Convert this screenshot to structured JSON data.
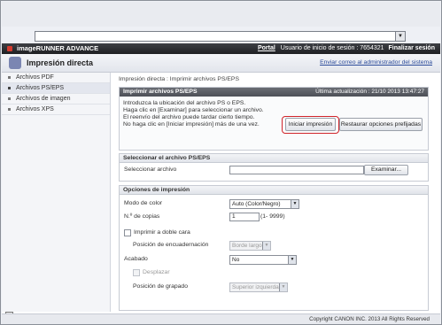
{
  "header": {
    "brand": "imageRUNNER ADVANCE",
    "portal": "Portal",
    "login": "Usuario de inicio de sesión : 7654321",
    "logout": "Finalizar sesión"
  },
  "titlebar": {
    "title": "Impresión directa",
    "mail": "Enviar correo al administrador del sistema"
  },
  "sidebar": {
    "items": [
      {
        "label": "Archivos PDF"
      },
      {
        "label": "Archivos PS/EPS"
      },
      {
        "label": "Archivos de imagen"
      },
      {
        "label": "Archivos XPS"
      }
    ]
  },
  "breadcrumb": "Impresión directa : Imprimir archivos PS/EPS",
  "panel": {
    "title": "Imprimir archivos PS/EPS",
    "updated": "Última actualización : 21/10 2013 13:47:27",
    "lines": [
      "Introduzca la ubicación del archivo PS o EPS.",
      "Haga clic en [Examinar] para seleccionar un archivo.",
      "El reenvío del archivo puede tardar cierto tiempo.",
      "No haga clic en [Iniciar impresión] más de una vez."
    ],
    "start_button": "Iniciar impresión",
    "restore_button": "Restaurar opciones prefijadas"
  },
  "select_file": {
    "header": "Seleccionar el archivo PS/EPS",
    "label": "Seleccionar archivo",
    "value": "",
    "browse_button": "Examinar..."
  },
  "options": {
    "header": "Opciones de impresión",
    "color_mode_label": "Modo de color",
    "color_mode_value": "Auto (Color/Negro)",
    "copies_label": "N.º de copias",
    "copies_value": "1",
    "copies_range": "(1- 9999)",
    "duplex_label": "Imprimir a doble cara",
    "binding_label": "Posición de encuadernación",
    "binding_value": "Borde largo",
    "finishing_label": "Acabado",
    "finishing_value": "No",
    "offset_label": "Desplazar",
    "staple_label": "Posición de grapado",
    "staple_value": "Superior izquierda"
  },
  "footer": {
    "copyright": "Copyright CANON INC. 2013 All Rights Reserved"
  },
  "colors": {
    "highlight": "#d0242a",
    "header_dark": "#2a2b2f",
    "link": "#2a4a9a"
  }
}
